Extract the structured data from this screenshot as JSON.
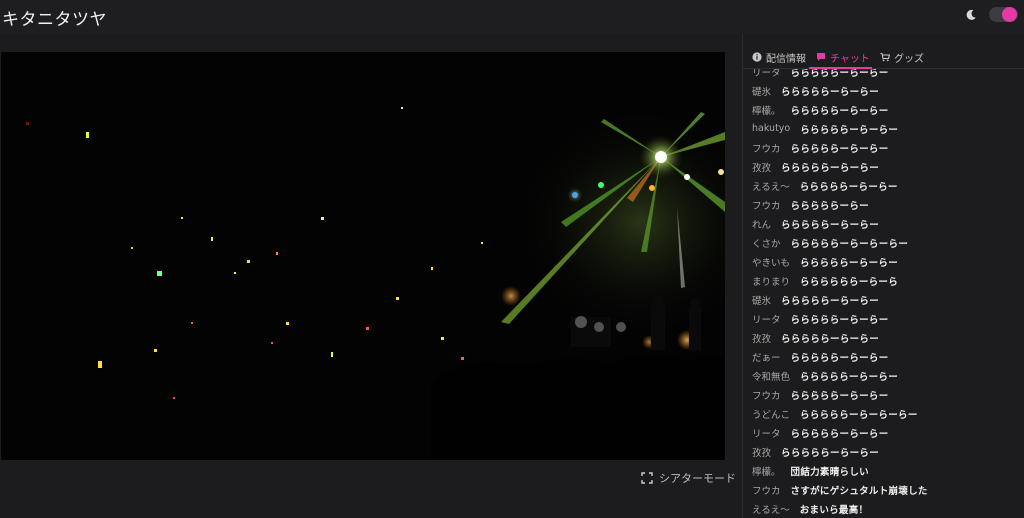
{
  "header": {
    "title": "キタニタツヤ",
    "theme_icon": "moon-icon",
    "toggle_on": true,
    "accent_color": "#e43aa6"
  },
  "player": {
    "theater_mode_label": "シアターモード",
    "theater_icon": "expand-icon"
  },
  "sidebar": {
    "tabs": [
      {
        "label": "配信情報",
        "icon": "info-icon",
        "active": false
      },
      {
        "label": "チャット",
        "icon": "chat-icon",
        "active": true
      },
      {
        "label": "グッズ",
        "icon": "cart-icon",
        "active": false
      }
    ]
  },
  "chat": {
    "messages": [
      {
        "name": "リータ",
        "text": "らららららーらーらー"
      },
      {
        "name": "礎氷",
        "text": "らららららーらーらー"
      },
      {
        "name": "檸檬。",
        "text": "らららららーらーらー"
      },
      {
        "name": "hakutyo",
        "text": "らららららーらーらー"
      },
      {
        "name": "フウカ",
        "text": "らららららーらーらー"
      },
      {
        "name": "孜孜",
        "text": "らららららーらーらー"
      },
      {
        "name": "えるえ〜",
        "text": "らららららーらーらー"
      },
      {
        "name": "フウカ",
        "text": "らららららーらー"
      },
      {
        "name": "れん",
        "text": "らららららーらーらー"
      },
      {
        "name": "くさか",
        "text": "らららららーらーらーらー"
      },
      {
        "name": "やきいも",
        "text": "らららららーらーらー"
      },
      {
        "name": "まりまり",
        "text": "ららららららーらーら"
      },
      {
        "name": "礎氷",
        "text": "らららららーらーらー"
      },
      {
        "name": "リータ",
        "text": "らららららーらーらー"
      },
      {
        "name": "孜孜",
        "text": "らららららーらーらー"
      },
      {
        "name": "だぁー",
        "text": "らららららーらーらー"
      },
      {
        "name": "令和無色",
        "text": "らららららーらーらー"
      },
      {
        "name": "フウカ",
        "text": "らららららーらーらー"
      },
      {
        "name": "うどんこ",
        "text": "らららららーらーらーらー"
      },
      {
        "name": "リータ",
        "text": "らららららーらーらー"
      },
      {
        "name": "孜孜",
        "text": "らららららーらーらー"
      },
      {
        "name": "檸檬。",
        "text": "団結力素晴らしい"
      },
      {
        "name": "フウカ",
        "text": "さすがにゲシュタルト崩壊した"
      },
      {
        "name": "えるえ〜",
        "text": "おまいら最高！"
      }
    ]
  }
}
